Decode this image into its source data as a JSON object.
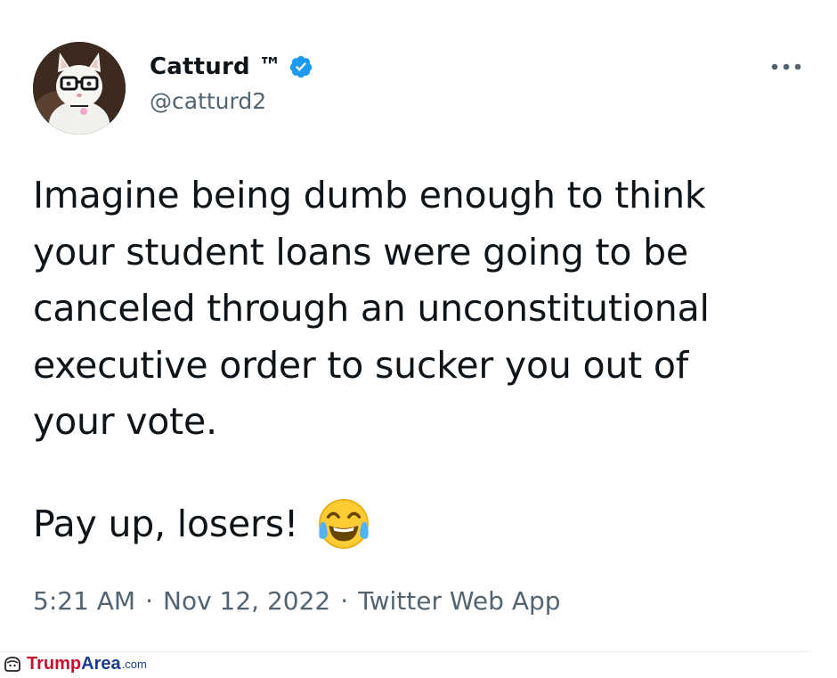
{
  "user": {
    "display_name": "Catturd ™",
    "handle": "@catturd2",
    "verified": true,
    "verified_color": "#1d9bf0"
  },
  "tweet": {
    "text": "Imagine being dumb enough to think\nyour student loans were going to be\ncanceled through an unconstitutional\nexecutive order to sucker you out of\nyour vote.",
    "text_second": "Pay up, losers!",
    "emoji": "face-with-tears-of-joy",
    "time": "5:21 AM",
    "date": "Nov 12, 2022",
    "separator": "·",
    "source": "Twitter Web App"
  },
  "icons": {
    "more": "more-horizontal-icon",
    "verified": "verified-badge-icon",
    "avatar": "cat-with-glasses-avatar"
  },
  "watermark": {
    "part1": "Trump",
    "part2": "Area",
    "part3": ".com"
  },
  "colors": {
    "text_primary": "#0f1419",
    "text_secondary": "#536471",
    "watermark_red": "#c8102e",
    "watermark_blue": "#1a3e8c"
  }
}
